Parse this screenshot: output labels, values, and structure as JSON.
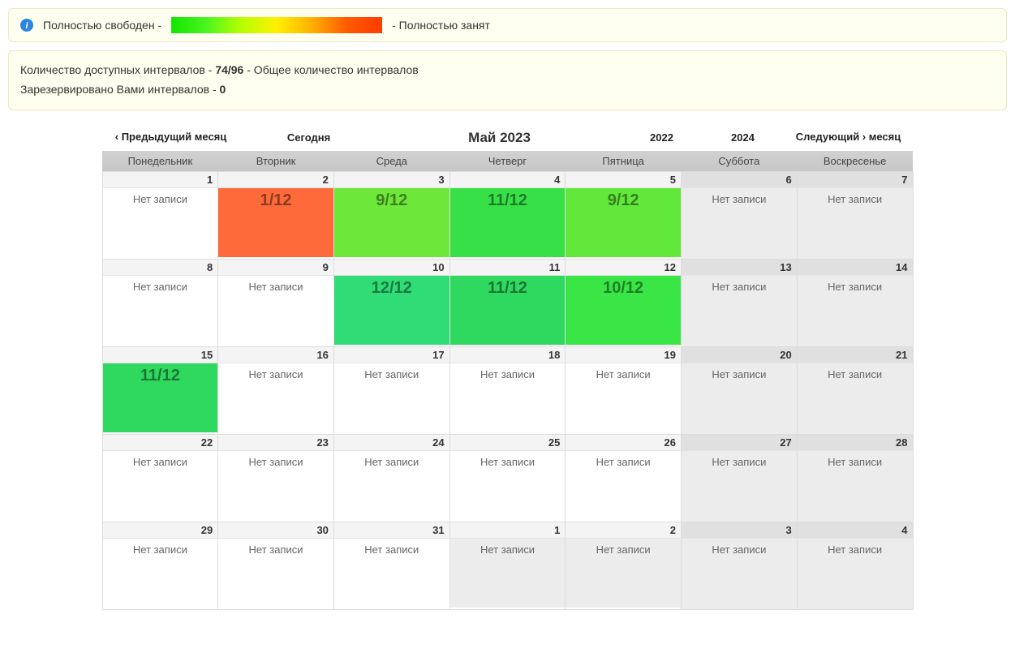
{
  "legend": {
    "free_label": "Полностью свободен -",
    "busy_label": "- Полностью занят"
  },
  "stats": {
    "available_label": "Количество доступных интервалов -",
    "available_value": "74/96",
    "total_label": "- Общее количество интервалов",
    "reserved_label": "Зарезервировано Вами интервалов -",
    "reserved_value": "0"
  },
  "nav": {
    "prev": "‹ Предыдущий месяц",
    "today": "Сегодня",
    "title": "Май 2023",
    "year_prev": "2022",
    "year_next": "2024",
    "next": "Следующий › месяц"
  },
  "weekdays": [
    "Понедельник",
    "Вторник",
    "Среда",
    "Четверг",
    "Пятница",
    "Суббота",
    "Воскресенье"
  ],
  "no_record_text": "Нет записи",
  "cells": [
    [
      {
        "day": "1",
        "type": "none"
      },
      {
        "day": "2",
        "type": "slot",
        "text": "1/12",
        "color": "#ff6a3a"
      },
      {
        "day": "3",
        "type": "slot",
        "text": "9/12",
        "color": "#6de73a"
      },
      {
        "day": "4",
        "type": "slot",
        "text": "11/12",
        "color": "#38e048"
      },
      {
        "day": "5",
        "type": "slot",
        "text": "9/12",
        "color": "#62e83a"
      },
      {
        "day": "6",
        "type": "none",
        "weekend": true
      },
      {
        "day": "7",
        "type": "none",
        "weekend": true
      }
    ],
    [
      {
        "day": "8",
        "type": "none"
      },
      {
        "day": "9",
        "type": "none"
      },
      {
        "day": "10",
        "type": "slot",
        "text": "12/12",
        "color": "#2fdc75"
      },
      {
        "day": "11",
        "type": "slot",
        "text": "11/12",
        "color": "#2fd85e"
      },
      {
        "day": "12",
        "type": "slot",
        "text": "10/12",
        "color": "#39e646"
      },
      {
        "day": "13",
        "type": "none",
        "weekend": true
      },
      {
        "day": "14",
        "type": "none",
        "weekend": true
      }
    ],
    [
      {
        "day": "15",
        "type": "slot",
        "text": "11/12",
        "color": "#2fd85e"
      },
      {
        "day": "16",
        "type": "none"
      },
      {
        "day": "17",
        "type": "none"
      },
      {
        "day": "18",
        "type": "none"
      },
      {
        "day": "19",
        "type": "none"
      },
      {
        "day": "20",
        "type": "none",
        "weekend": true
      },
      {
        "day": "21",
        "type": "none",
        "weekend": true
      }
    ],
    [
      {
        "day": "22",
        "type": "none"
      },
      {
        "day": "23",
        "type": "none"
      },
      {
        "day": "24",
        "type": "none"
      },
      {
        "day": "25",
        "type": "none"
      },
      {
        "day": "26",
        "type": "none"
      },
      {
        "day": "27",
        "type": "none",
        "weekend": true
      },
      {
        "day": "28",
        "type": "none",
        "weekend": true
      }
    ],
    [
      {
        "day": "29",
        "type": "none"
      },
      {
        "day": "30",
        "type": "none"
      },
      {
        "day": "31",
        "type": "none"
      },
      {
        "day": "1",
        "type": "none",
        "other": true
      },
      {
        "day": "2",
        "type": "none",
        "other": true
      },
      {
        "day": "3",
        "type": "none",
        "other": true,
        "weekend": true
      },
      {
        "day": "4",
        "type": "none",
        "other": true,
        "weekend": true
      }
    ]
  ]
}
